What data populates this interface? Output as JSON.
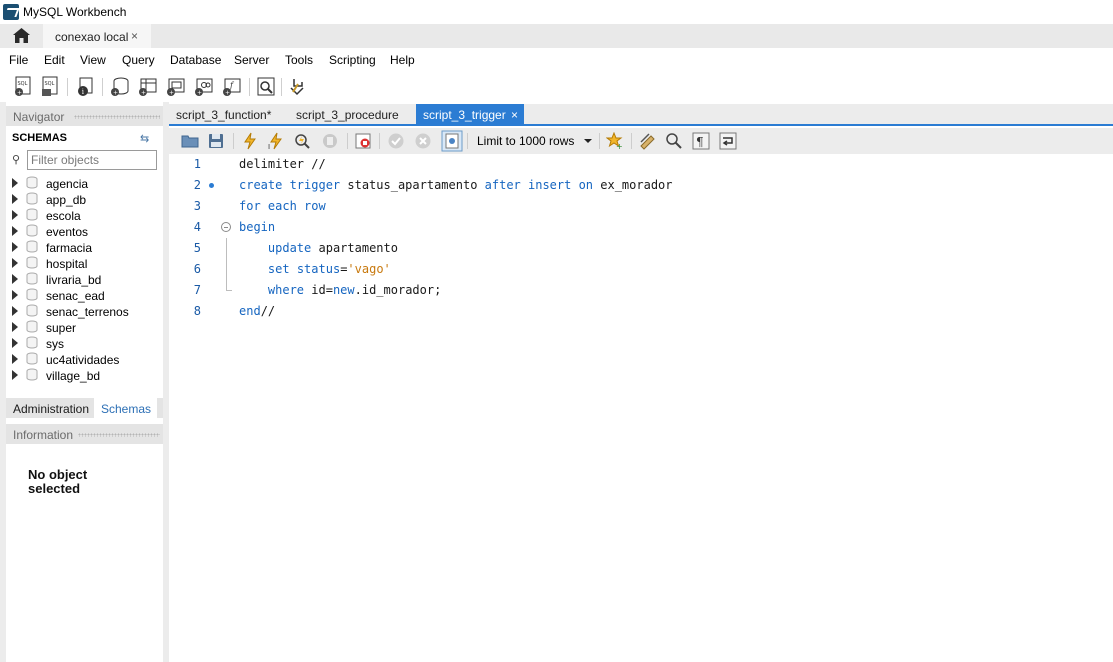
{
  "window": {
    "title": "MySQL Workbench"
  },
  "connection_tabs": [
    {
      "label": "conexao local",
      "close": "×"
    }
  ],
  "menu": [
    "File",
    "Edit",
    "View",
    "Query",
    "Database",
    "Server",
    "Tools",
    "Scripting",
    "Help"
  ],
  "navigator": {
    "header": "Navigator",
    "schemas_label": "SCHEMAS",
    "filter_placeholder": "Filter objects",
    "schemas": [
      "agencia",
      "app_db",
      "escola",
      "eventos",
      "farmacia",
      "hospital",
      "livraria_bd",
      "senac_ead",
      "senac_terrenos",
      "super",
      "sys",
      "uc4atividades",
      "village_bd"
    ],
    "tabs": {
      "administration": "Administration",
      "schemas": "Schemas"
    },
    "information_header": "Information",
    "info_text_line1": "No object",
    "info_text_line2": "selected"
  },
  "editor": {
    "tabs": [
      {
        "label": "script_3_function*",
        "active": false
      },
      {
        "label": "script_3_procedure",
        "active": false
      },
      {
        "label": "script_3_trigger",
        "active": true,
        "close": "×"
      }
    ],
    "limit_label": "Limit to 1000 rows",
    "lines": [
      {
        "n": "1",
        "text": "delimiter //"
      },
      {
        "n": "2",
        "text": "create trigger status_apartamento after insert on ex_morador"
      },
      {
        "n": "3",
        "text": "for each row"
      },
      {
        "n": "4",
        "text": "begin"
      },
      {
        "n": "5",
        "text": "    update apartamento"
      },
      {
        "n": "6",
        "text": "    set status='vago'"
      },
      {
        "n": "7",
        "text": "    where id=new.id_morador;"
      },
      {
        "n": "8",
        "text": "end//"
      }
    ]
  },
  "colors": {
    "accent": "#2b7cd3",
    "keyword": "#1565c0",
    "string": "#c8790e"
  }
}
